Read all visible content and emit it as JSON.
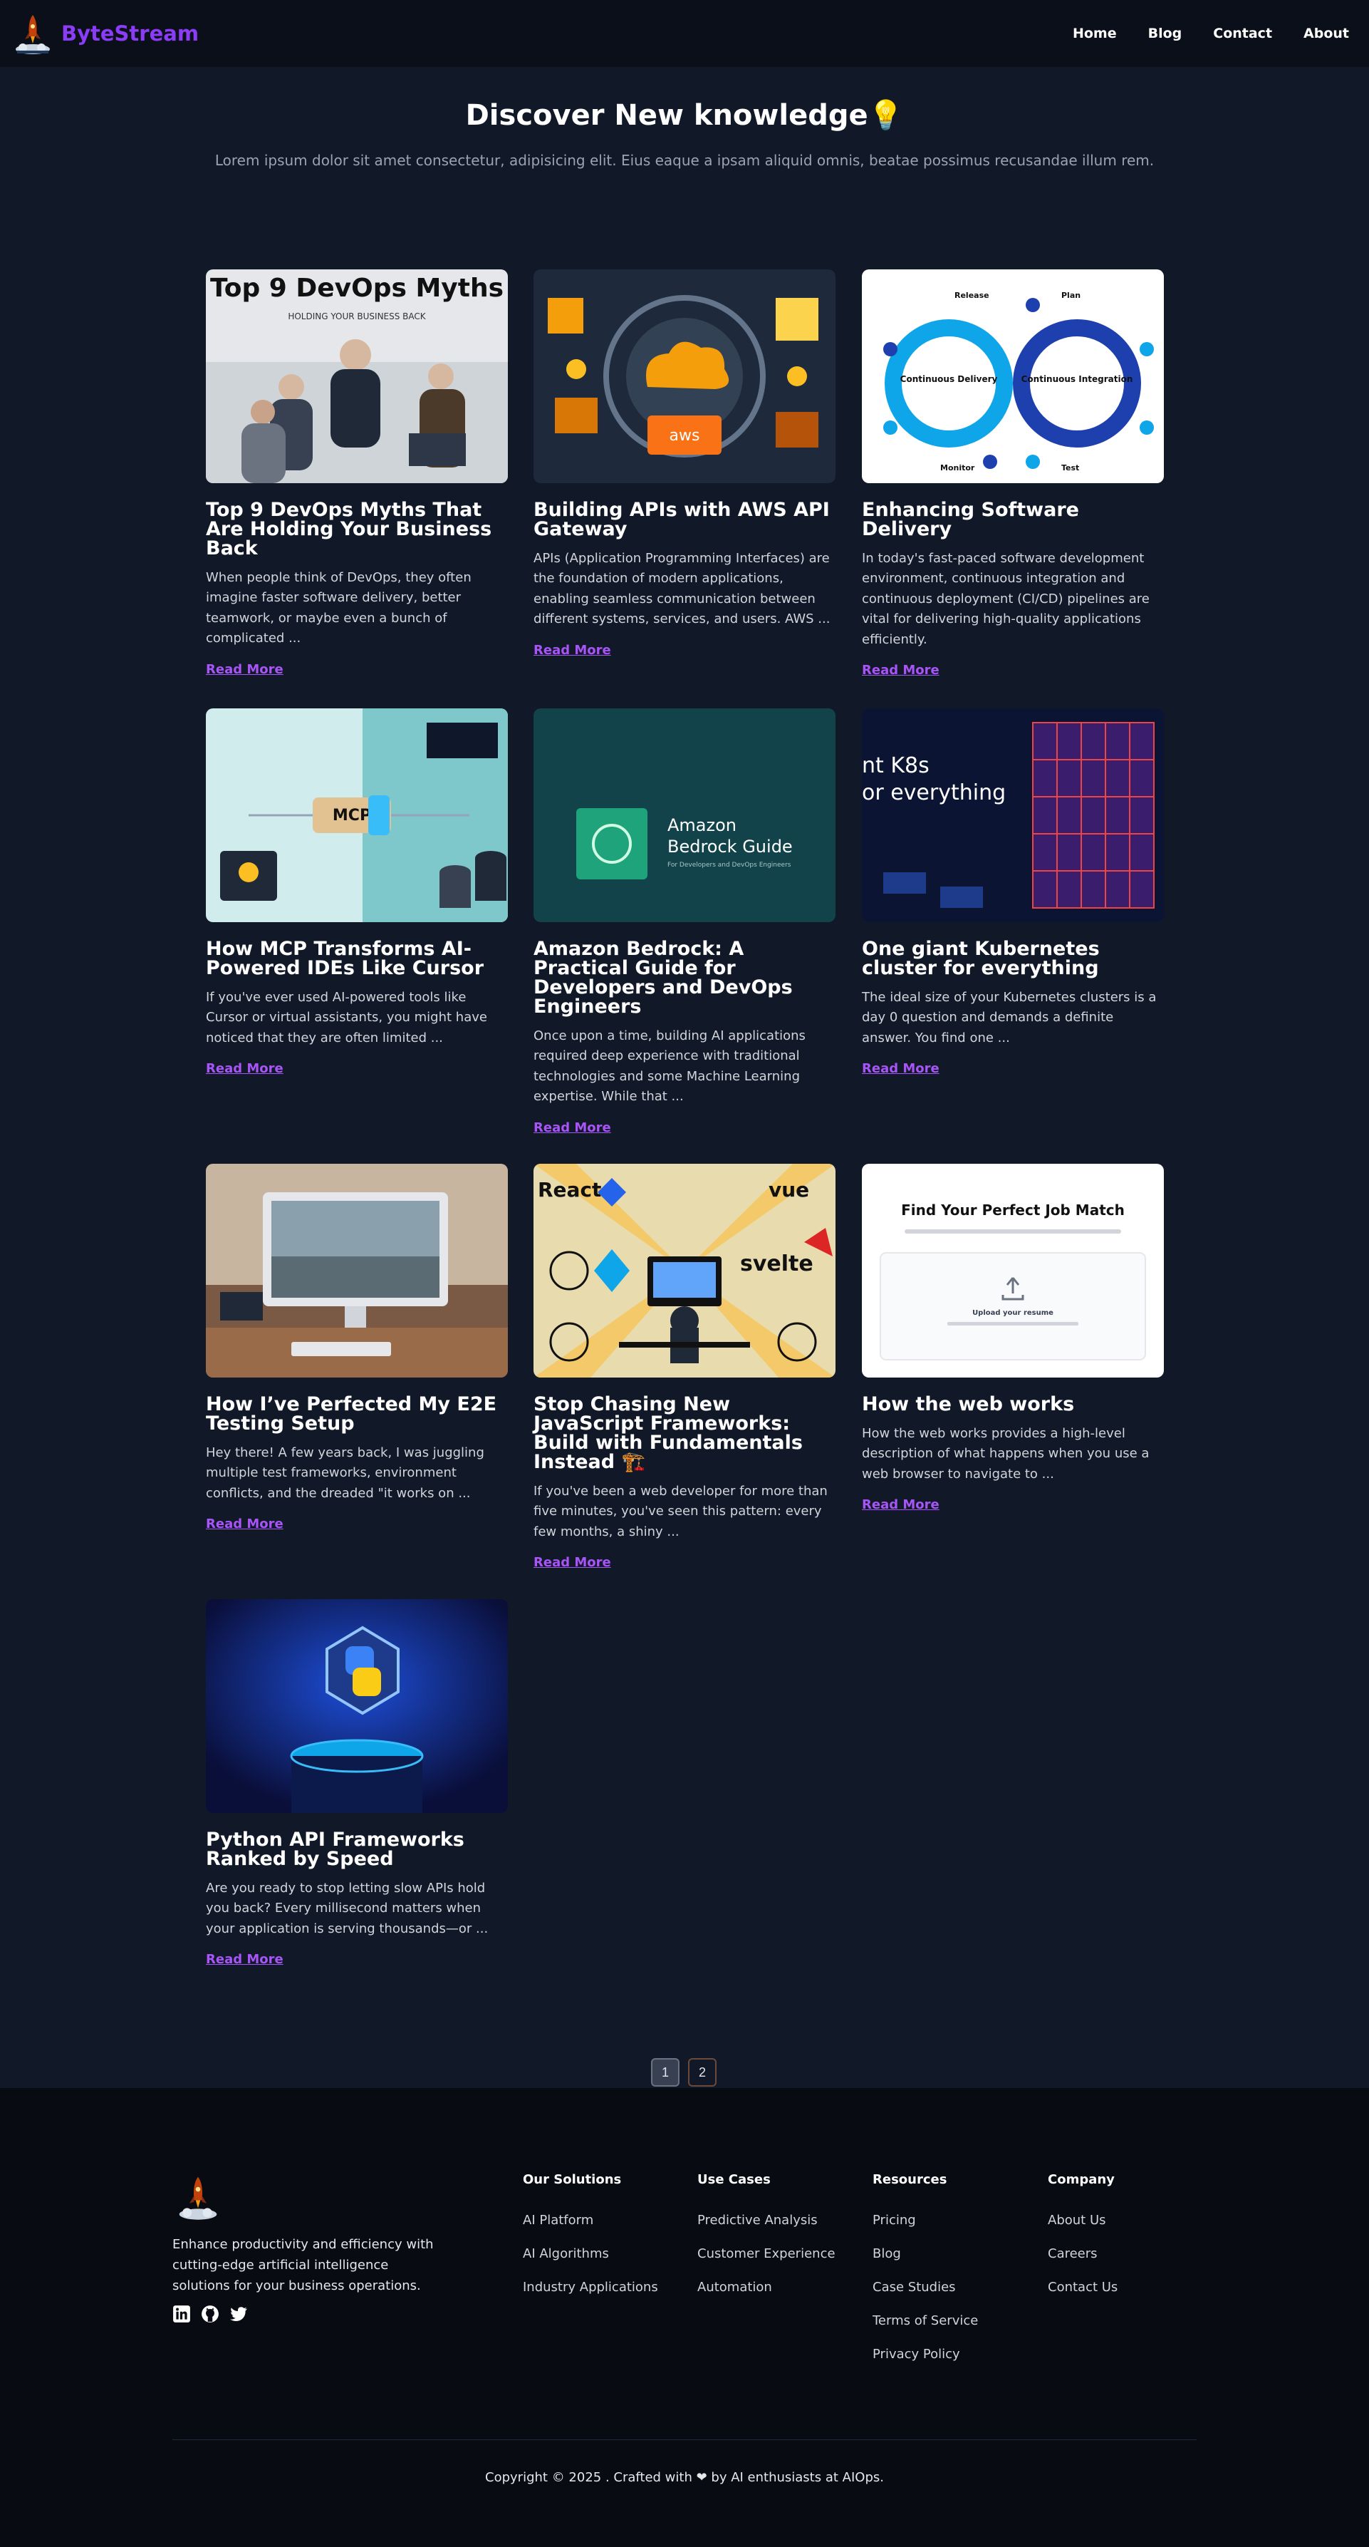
{
  "nav": {
    "brand": "ByteStream",
    "links": [
      "Home",
      "Blog",
      "Contact",
      "About"
    ]
  },
  "hero": {
    "title": "Discover New knowledge💡",
    "subtitle": "Lorem ipsum dolor sit amet consectetur, adipisicing elit. Eius eaque a ipsam aliquid omnis, beatae possimus recusandae illum rem."
  },
  "posts": [
    {
      "title": "Top 9 DevOps Myths That Are Holding Your Business Back",
      "excerpt": "When people think of DevOps, they often imagine faster software delivery, better teamwork, or maybe even a bunch of complicated ...",
      "link": "Read More",
      "image_text": "Top 9 DevOps Myths",
      "image_subtext": "HOLDING YOUR BUSINESS BACK"
    },
    {
      "title": "Building APIs with AWS API Gateway",
      "excerpt": "APIs (Application Programming Interfaces) are the foundation of modern applications, enabling seamless communication between different systems, services, and users. AWS ...",
      "link": "Read More",
      "image_text": "aws"
    },
    {
      "title": "Enhancing Software Delivery",
      "excerpt": "In today's fast-paced software development environment, continuous integration and continuous deployment (CI/CD) pipelines are vital for delivering high-quality applications efficiently.",
      "link": "Read More",
      "image_labels": [
        "Continuous Delivery",
        "Continuous Integration",
        "Release",
        "Plan",
        "Monitor",
        "Test"
      ]
    },
    {
      "title": "How MCP Transforms AI-Powered IDEs Like Cursor",
      "excerpt": "If you've ever used AI-powered tools like Cursor or virtual assistants, you might have noticed that they are often limited ...",
      "link": "Read More",
      "image_text": "MCP"
    },
    {
      "title": "Amazon Bedrock: A Practical Guide for Developers and DevOps Engineers",
      "excerpt": "Once upon a time, building AI applications required deep experience with traditional technologies and some Machine Learning expertise. While that ...",
      "link": "Read More",
      "image_text": "Amazon Bedrock Guide",
      "image_subtext": "For Developers and DevOps Engineers"
    },
    {
      "title": "One giant Kubernetes cluster for everything",
      "excerpt": "The ideal size of your Kubernetes clusters is a day 0 question and demands a definite answer. You find one ...",
      "link": "Read More",
      "image_text": "nt K8s\nor everything"
    },
    {
      "title": "How I’ve Perfected My E2E Testing Setup",
      "excerpt": "Hey there! A few years back, I was juggling multiple test frameworks, environment conflicts, and the dreaded \"it works on ...",
      "link": "Read More"
    },
    {
      "title": "Stop Chasing New JavaScript Frameworks: Build with Fundamentals Instead 🏗️",
      "excerpt": "If you've been a web developer for more than five minutes, you've seen this pattern: every few months, a shiny ...",
      "link": "Read More",
      "image_labels": [
        "React",
        "vue",
        "svelte"
      ]
    },
    {
      "title": "How the web works",
      "excerpt": "How the web works provides a high-level description of what happens when you use a web browser to navigate to ...",
      "link": "Read More",
      "image_text": "Find Your Perfect Job Match",
      "image_subtext": "Upload your resume"
    },
    {
      "title": "Python API Frameworks Ranked by Speed",
      "excerpt": "Are you ready to stop letting slow APIs hold you back? Every millisecond matters when your application is serving thousands—or ...",
      "link": "Read More"
    }
  ],
  "pagination": {
    "pages": [
      "1",
      "2"
    ],
    "current": "1"
  },
  "footer": {
    "description": "Enhance productivity and efficiency with cutting-edge artificial intelligence solutions for your business operations.",
    "social": [
      "linkedin-icon",
      "github-icon",
      "twitter-icon"
    ],
    "columns": [
      {
        "title": "Our Solutions",
        "items": [
          "AI Platform",
          "AI Algorithms",
          "Industry Applications"
        ]
      },
      {
        "title": "Use Cases",
        "items": [
          "Predictive Analysis",
          "Customer Experience",
          "Automation"
        ]
      },
      {
        "title": "Resources",
        "items": [
          "Pricing",
          "Blog",
          "Case Studies",
          "Terms of Service",
          "Privacy Policy"
        ]
      },
      {
        "title": "Company",
        "items": [
          "About Us",
          "Careers",
          "Contact Us"
        ]
      }
    ],
    "copyright": "Copyright © 2025 . Crafted with ❤ by AI enthusiasts at AIOps."
  },
  "colors": {
    "background": "#111827",
    "navbar": "#0b0f19",
    "footer": "#080b12",
    "brand": "#8b3cf6",
    "link": "#a855f7"
  }
}
